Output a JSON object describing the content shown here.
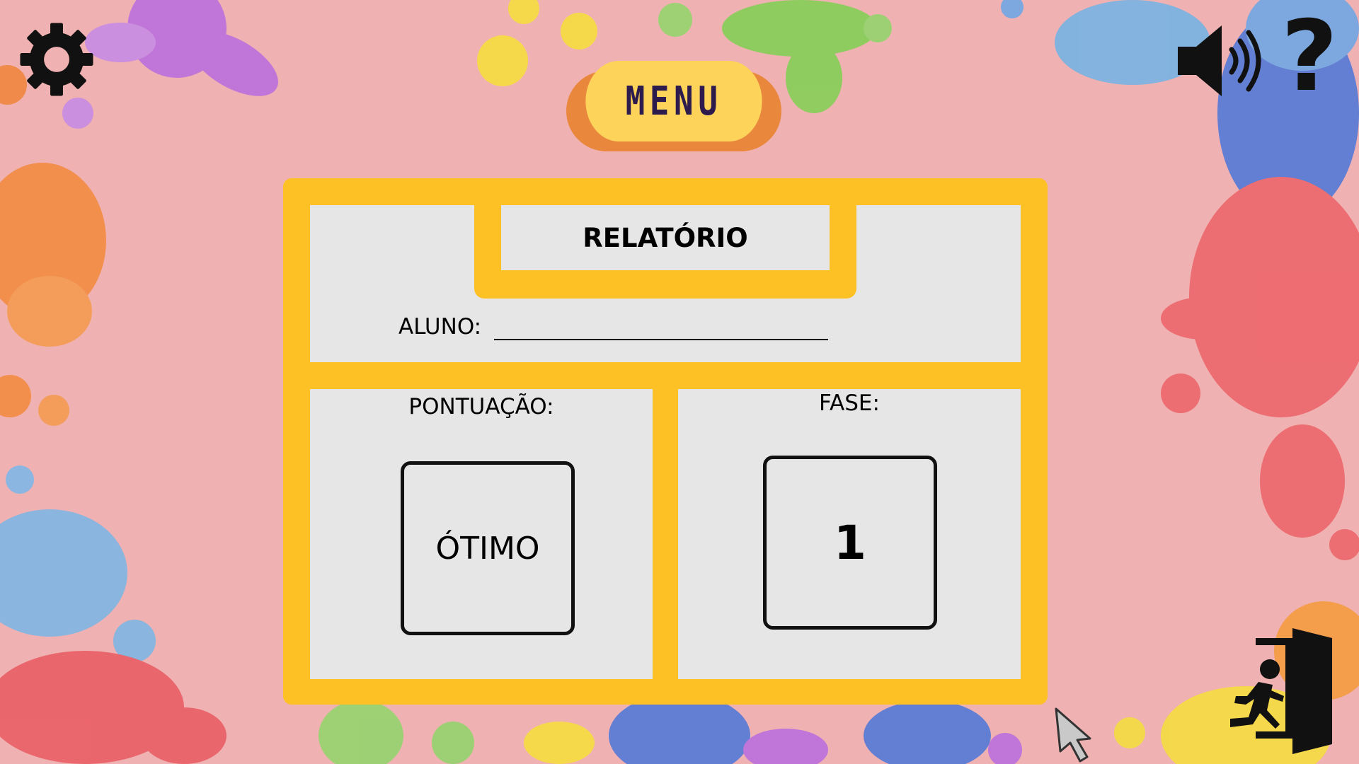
{
  "icons": {
    "settings": "gear-icon",
    "sound": "speaker-icon",
    "help": "question-icon",
    "exit": "exit-door-icon",
    "cursor": "mouse-cursor-icon"
  },
  "help_glyph": "?",
  "menu_button": {
    "label": "MENU"
  },
  "report": {
    "title": "RELATÓRIO",
    "student_label": "ALUNO:",
    "student_name": "",
    "score_label": "PONTUAÇÃO:",
    "score_value": "ÓTIMO",
    "phase_label": "FASE:",
    "phase_value": "1"
  },
  "colors": {
    "background": "#efb1b1",
    "panel_frame": "#fdc125",
    "panel_fill": "#e6e6e6",
    "menu_button": "#fdd35a",
    "menu_button_shadow": "#e9883d",
    "menu_text": "#2d1b4e"
  }
}
